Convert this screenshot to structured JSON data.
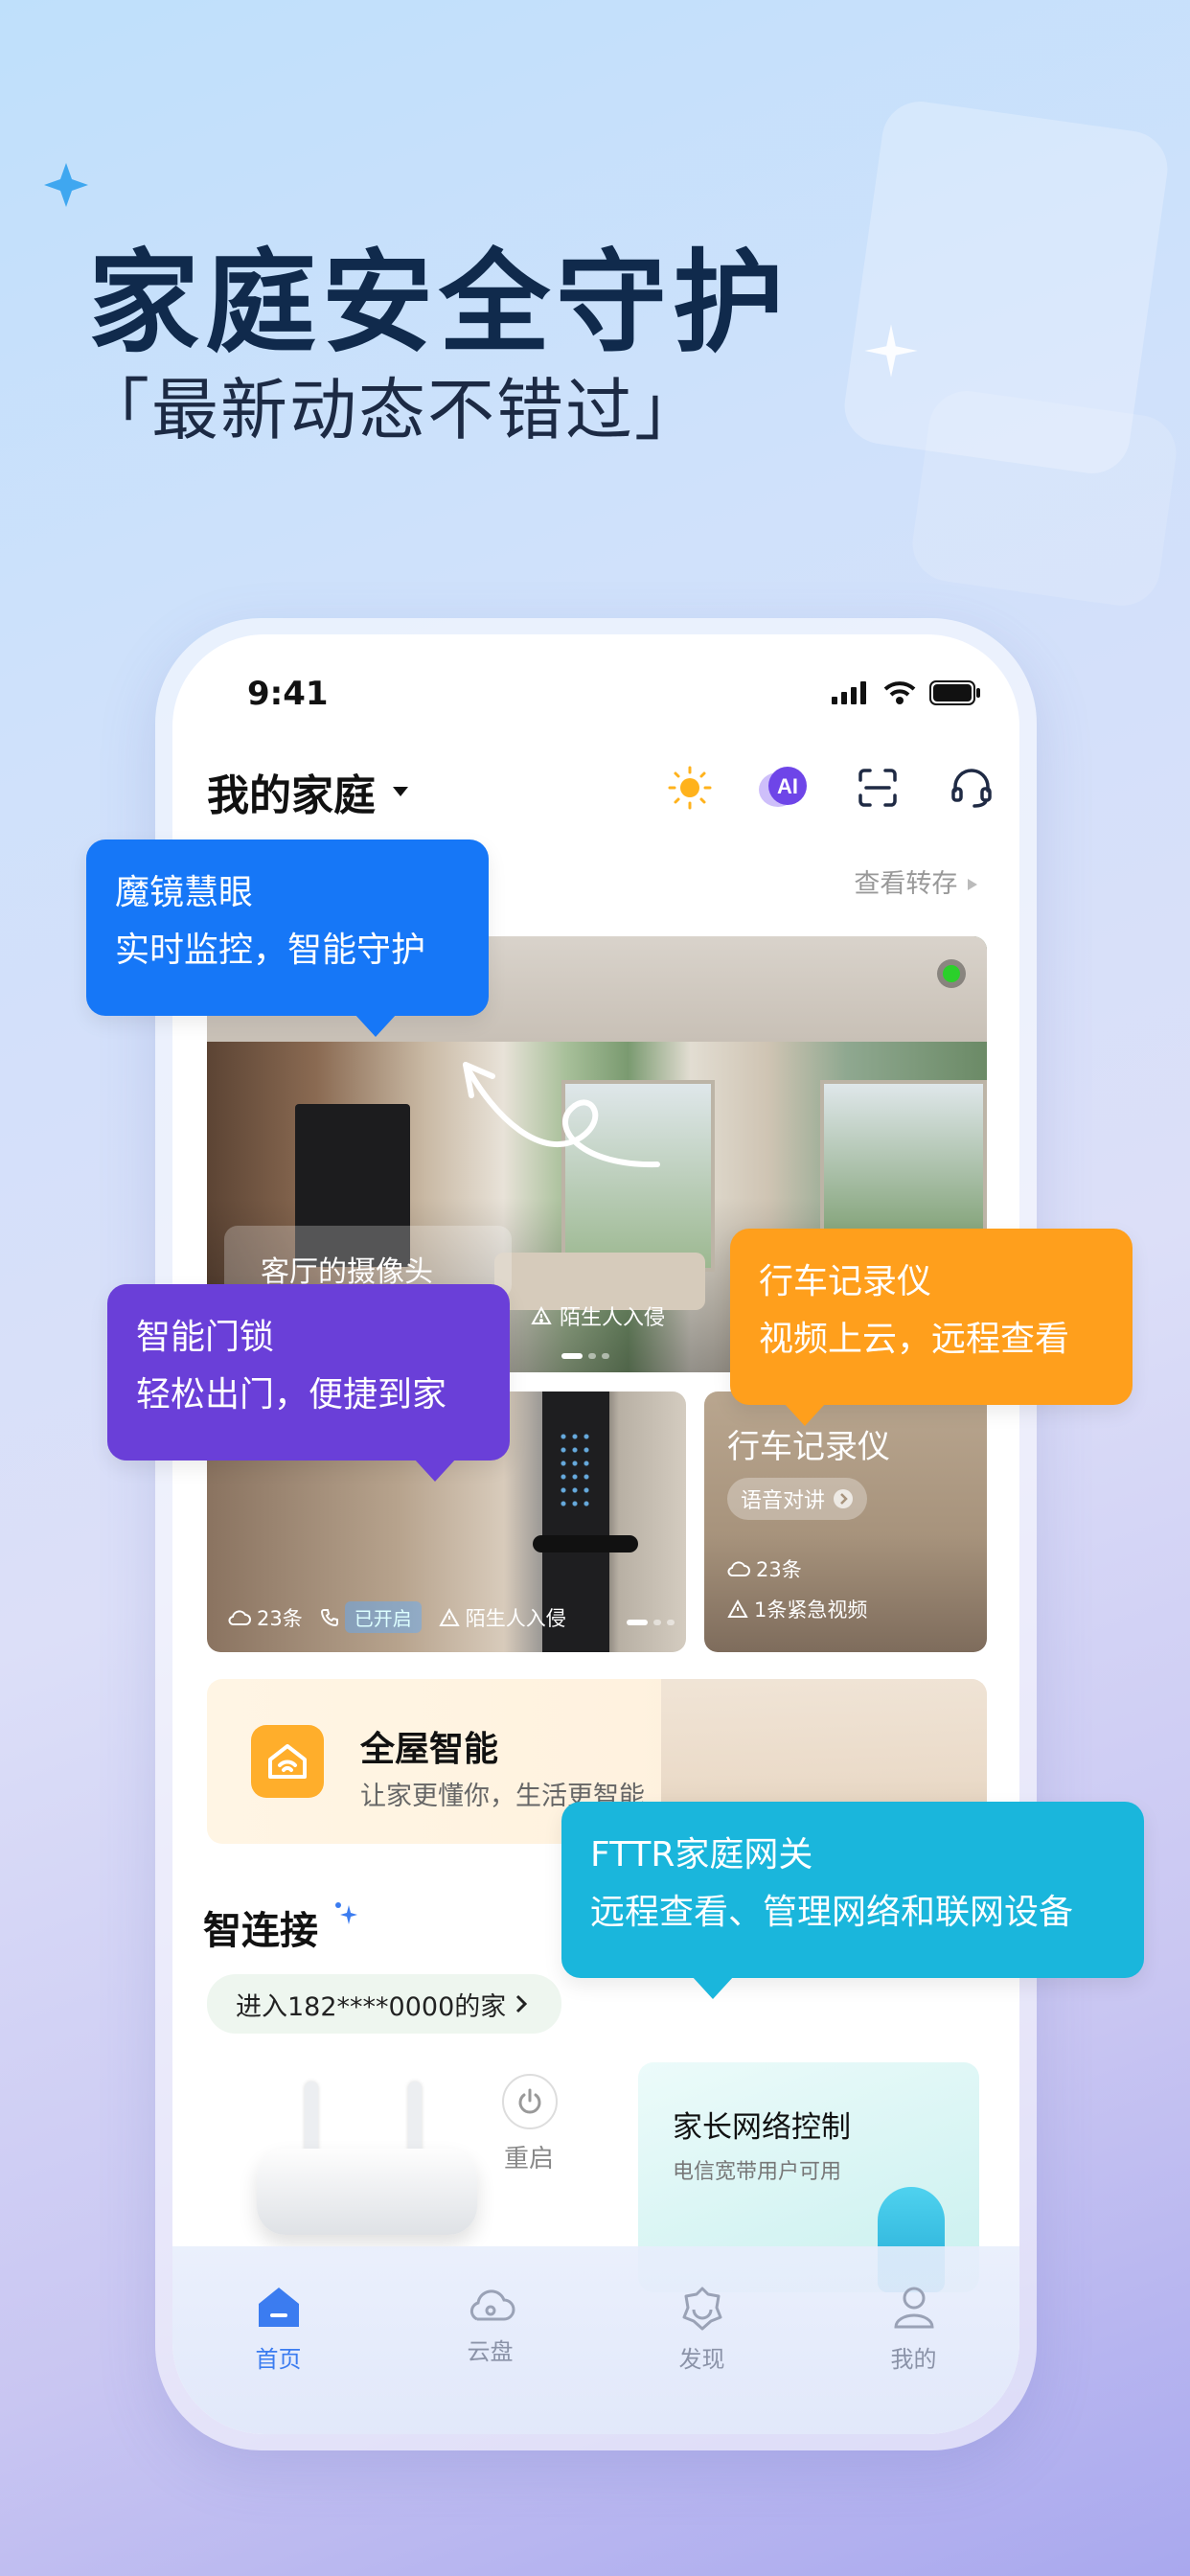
{
  "hero": {
    "title": "家庭安全守护",
    "subtitle": "「最新动态不错过」"
  },
  "status_bar": {
    "time": "9:41"
  },
  "header": {
    "home_title": "我的家庭",
    "ai_label": "AI",
    "view_transfer": "查看转存"
  },
  "camera": {
    "name": "客厅的摄像头",
    "stranger": "陌生人入侵"
  },
  "door_lock": {
    "records": "23条",
    "call_status": "已开启",
    "stranger": "陌生人入侵"
  },
  "dashcam": {
    "title": "行车记录仪",
    "voice_btn": "语音对讲",
    "records": "23条",
    "emergency": "1条紧急视频"
  },
  "smart_home": {
    "title": "全屋智能",
    "subtitle": "让家更懂你，生活更智能"
  },
  "smart_connect": {
    "title": "智连接",
    "enter": "进入182****0000的家",
    "restart": "重启",
    "parent_title": "家长网络控制",
    "parent_sub": "电信宽带用户可用"
  },
  "tabs": [
    {
      "label": "首页",
      "icon": "home-icon",
      "active": true
    },
    {
      "label": "云盘",
      "icon": "cloud-icon",
      "active": false
    },
    {
      "label": "发现",
      "icon": "discover-icon",
      "active": false
    },
    {
      "label": "我的",
      "icon": "profile-icon",
      "active": false
    }
  ],
  "bubbles": {
    "mirror": {
      "line1": "魔镜慧眼",
      "line2": "实时监控，智能守护"
    },
    "dashcam": {
      "line1": "行车记录仪",
      "line2": "视频上云，远程查看"
    },
    "lock": {
      "line1": "智能门锁",
      "line2": "轻松出门，便捷到家"
    },
    "fttr": {
      "line1": "FTTR家庭网关",
      "line2": "远程查看、管理网络和联网设备"
    }
  },
  "colors": {
    "primary_blue": "#1677f7",
    "orange": "#ff9f1c",
    "purple": "#6a3fd8",
    "cyan": "#1ab6dc",
    "tab_active": "#3b7cf0"
  }
}
